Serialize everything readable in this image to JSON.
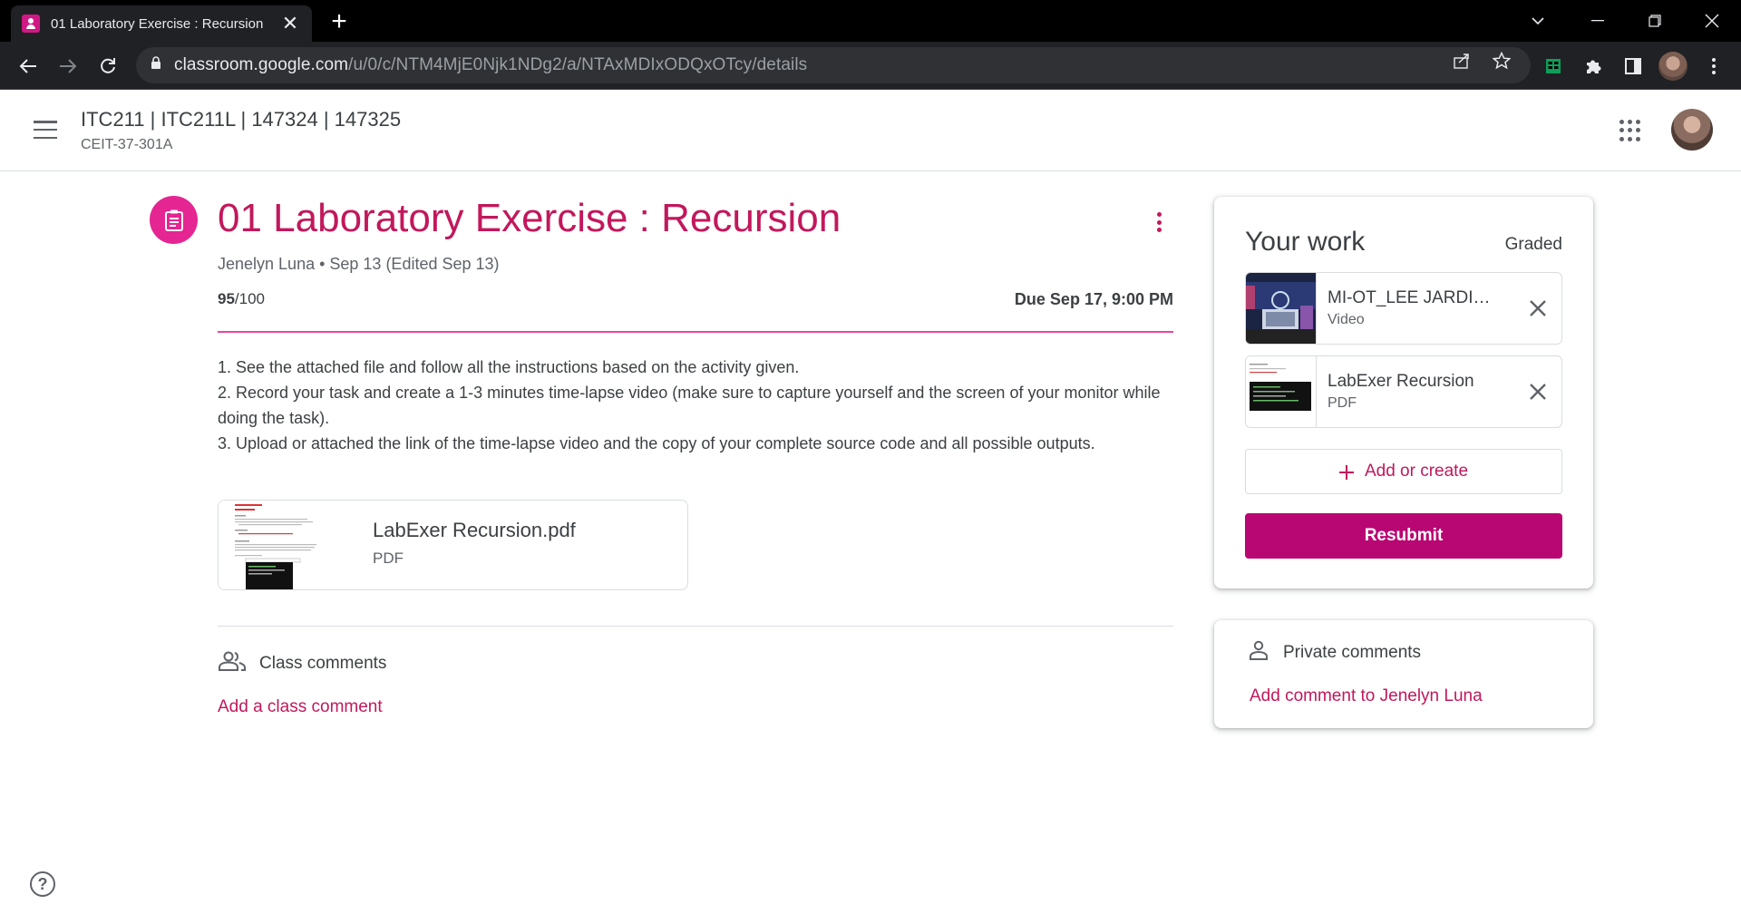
{
  "browser": {
    "tab_title": "01 Laboratory Exercise : Recursion",
    "tab_close": "✕",
    "new_tab": "+",
    "url_domain": "classroom.google.com",
    "url_path": "/u/0/c/NTM4MjE0Njk1NDg2/a/NTAxMDIxODQxOTcy/details"
  },
  "header": {
    "class_title": "ITC211 | ITC211L | 147324 | 147325",
    "section": "CEIT-37-301A"
  },
  "assignment": {
    "title": "01 Laboratory Exercise : Recursion",
    "meta": "Jenelyn Luna • Sep 13 (Edited Sep 13)",
    "grade_value": "95",
    "grade_total": "/100",
    "due": "Due Sep 17, 9:00 PM",
    "instructions": [
      "1. See the attached file and follow all the instructions based on the activity given.",
      "2. Record your task and create a 1-3 minutes time-lapse video (make sure to capture yourself and the screen of your monitor while doing the task).",
      "3. Upload or attached the link of the time-lapse video and the copy of your complete source code and all possible outputs."
    ],
    "attachment": {
      "name": "LabExer Recursion.pdf",
      "type": "PDF"
    }
  },
  "comments": {
    "class_label": "Class comments",
    "add_class": "Add a class comment",
    "private_label": "Private comments",
    "add_private": "Add comment to Jenelyn Luna"
  },
  "work": {
    "title": "Your work",
    "status": "Graded",
    "files": [
      {
        "name": "MI-OT_LEE JARDINEL",
        "type": "Video"
      },
      {
        "name": "LabExer Recursion",
        "type": "PDF"
      }
    ],
    "add_create": "Add or create",
    "resubmit": "Resubmit"
  },
  "help": "?",
  "colors": {
    "accent": "#c2185b",
    "button": "#b80672",
    "icon_bg": "#e52592"
  }
}
